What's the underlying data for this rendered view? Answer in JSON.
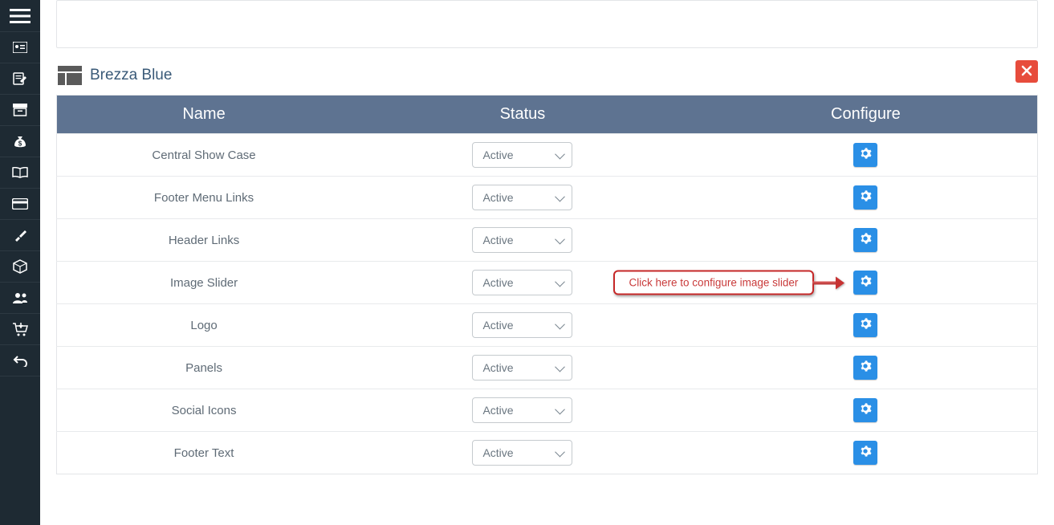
{
  "panel": {
    "title": "Brezza Blue",
    "callout_text": "Click here to configure image slider"
  },
  "table": {
    "headers": {
      "name": "Name",
      "status": "Status",
      "configure": "Configure"
    },
    "rows": [
      {
        "name": "Central Show Case",
        "status": "Active",
        "callout": false
      },
      {
        "name": "Footer Menu Links",
        "status": "Active",
        "callout": false
      },
      {
        "name": "Header Links",
        "status": "Active",
        "callout": false
      },
      {
        "name": "Image Slider",
        "status": "Active",
        "callout": true
      },
      {
        "name": "Logo",
        "status": "Active",
        "callout": false
      },
      {
        "name": "Panels",
        "status": "Active",
        "callout": false
      },
      {
        "name": "Social Icons",
        "status": "Active",
        "callout": false
      },
      {
        "name": "Footer Text",
        "status": "Active",
        "callout": false
      }
    ]
  },
  "sidebar_icons": [
    "menu",
    "id-card",
    "edit-note",
    "archive",
    "money-bag",
    "book",
    "card",
    "brush",
    "box",
    "users",
    "cart-down",
    "undo"
  ]
}
